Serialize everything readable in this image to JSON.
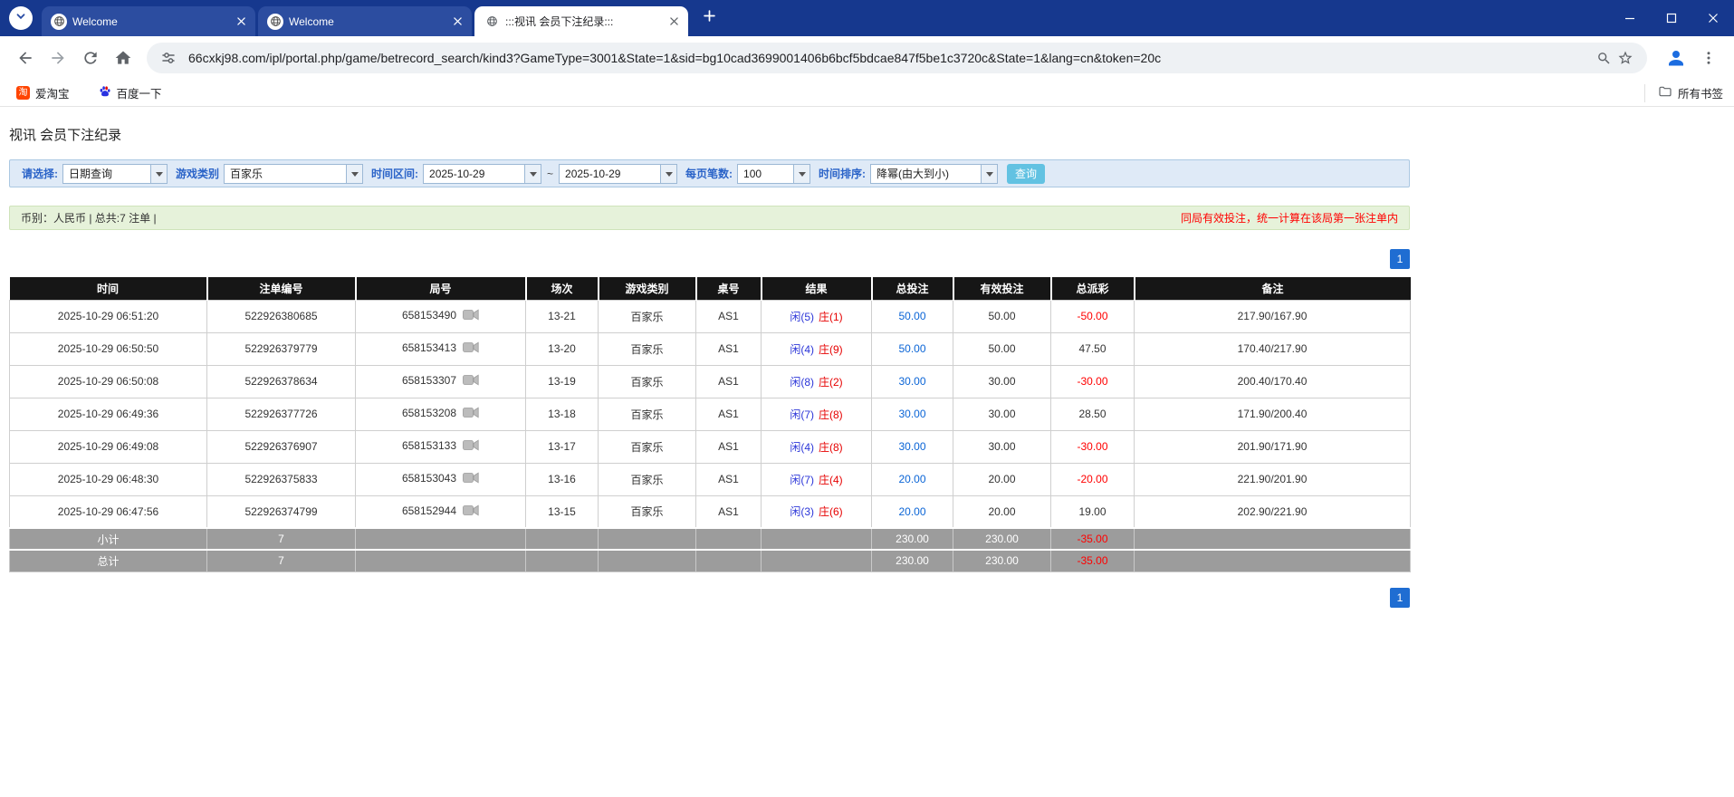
{
  "browser": {
    "tabs": [
      {
        "label": "Welcome"
      },
      {
        "label": "Welcome"
      },
      {
        "label": ":::视讯 会员下注纪录:::"
      }
    ],
    "url": "66cxkj98.com/ipl/portal.php/game/betrecord_search/kind3?GameType=3001&State=1&sid=bg10cad3699001406b6bcf5bdcae847f5be1c3720c&State=1&lang=cn&token=20c",
    "bookmarks": {
      "items": [
        {
          "label": "爱淘宝",
          "favicon_text": "淘"
        },
        {
          "label": "百度一下"
        }
      ],
      "all_bookmarks": "所有书签"
    }
  },
  "page": {
    "title": "视讯 会员下注纪录",
    "filters": {
      "select_label": "请选择:",
      "select_value": "日期查询",
      "game_type_label": "游戏类别",
      "game_type_value": "百家乐",
      "time_range_label": "时间区间:",
      "date_from": "2025-10-29",
      "range_separator": "~",
      "date_to": "2025-10-29",
      "page_size_label": "每页笔数:",
      "page_size_value": "100",
      "sort_label": "时间排序:",
      "sort_value": "降幂(由大到小)",
      "search_button": "查询"
    },
    "info_bar": {
      "summary": "币别：人民币 | 总共:7 注单 |",
      "notice": "同局有效投注，统一计算在该局第一张注单内"
    },
    "pagination": {
      "page": "1"
    },
    "colors": {
      "player_blue": "#2b35d8",
      "banker_red": "#e60000",
      "bet_amount_blue": "#0a64d6",
      "negative_red": "#ff0000",
      "pagination_blue": "#1f6dd2",
      "header_black": "#161616",
      "summary_gray": "#9c9c9c"
    },
    "table": {
      "headers": [
        "时间",
        "注单编号",
        "局号",
        "场次",
        "游戏类别",
        "桌号",
        "结果",
        "总投注",
        "有效投注",
        "总派彩",
        "备注"
      ],
      "rows": [
        {
          "time": "2025-10-29 06:51:20",
          "bet_no": "522926380685",
          "round_no": "658153490",
          "session": "13-21",
          "game": "百家乐",
          "table_no": "AS1",
          "result_player": "闲(5)",
          "result_banker": "庄(1)",
          "total_bet": "50.00",
          "valid_bet": "50.00",
          "payout": "-50.00",
          "note": "217.90/167.90"
        },
        {
          "time": "2025-10-29 06:50:50",
          "bet_no": "522926379779",
          "round_no": "658153413",
          "session": "13-20",
          "game": "百家乐",
          "table_no": "AS1",
          "result_player": "闲(4)",
          "result_banker": "庄(9)",
          "total_bet": "50.00",
          "valid_bet": "50.00",
          "payout": "47.50",
          "note": "170.40/217.90"
        },
        {
          "time": "2025-10-29 06:50:08",
          "bet_no": "522926378634",
          "round_no": "658153307",
          "session": "13-19",
          "game": "百家乐",
          "table_no": "AS1",
          "result_player": "闲(8)",
          "result_banker": "庄(2)",
          "total_bet": "30.00",
          "valid_bet": "30.00",
          "payout": "-30.00",
          "note": "200.40/170.40"
        },
        {
          "time": "2025-10-29 06:49:36",
          "bet_no": "522926377726",
          "round_no": "658153208",
          "session": "13-18",
          "game": "百家乐",
          "table_no": "AS1",
          "result_player": "闲(7)",
          "result_banker": "庄(8)",
          "total_bet": "30.00",
          "valid_bet": "30.00",
          "payout": "28.50",
          "note": "171.90/200.40"
        },
        {
          "time": "2025-10-29 06:49:08",
          "bet_no": "522926376907",
          "round_no": "658153133",
          "session": "13-17",
          "game": "百家乐",
          "table_no": "AS1",
          "result_player": "闲(4)",
          "result_banker": "庄(8)",
          "total_bet": "30.00",
          "valid_bet": "30.00",
          "payout": "-30.00",
          "note": "201.90/171.90"
        },
        {
          "time": "2025-10-29 06:48:30",
          "bet_no": "522926375833",
          "round_no": "658153043",
          "session": "13-16",
          "game": "百家乐",
          "table_no": "AS1",
          "result_player": "闲(7)",
          "result_banker": "庄(4)",
          "total_bet": "20.00",
          "valid_bet": "20.00",
          "payout": "-20.00",
          "note": "221.90/201.90"
        },
        {
          "time": "2025-10-29 06:47:56",
          "bet_no": "522926374799",
          "round_no": "658152944",
          "session": "13-15",
          "game": "百家乐",
          "table_no": "AS1",
          "result_player": "闲(3)",
          "result_banker": "庄(6)",
          "total_bet": "20.00",
          "valid_bet": "20.00",
          "payout": "19.00",
          "note": "202.90/221.90"
        }
      ],
      "subtotal": {
        "label": "小计",
        "count": "7",
        "total_bet": "230.00",
        "valid_bet": "230.00",
        "payout": "-35.00"
      },
      "total": {
        "label": "总计",
        "count": "7",
        "total_bet": "230.00",
        "valid_bet": "230.00",
        "payout": "-35.00"
      }
    }
  }
}
